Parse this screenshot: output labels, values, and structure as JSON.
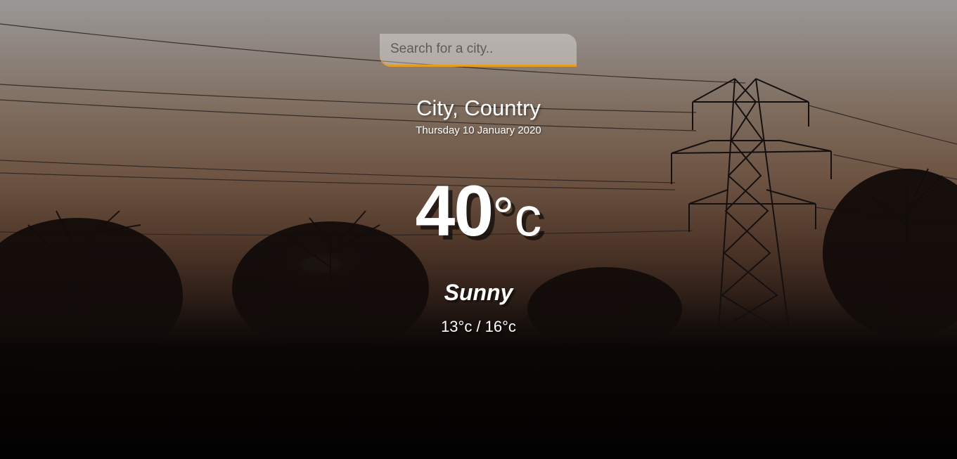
{
  "search": {
    "placeholder": "Search for a city.."
  },
  "location": {
    "name": "City, Country",
    "date": "Thursday 10 January 2020"
  },
  "current": {
    "temperature": "40",
    "unit": "°c",
    "condition": "Sunny",
    "hi_low": "13°c / 16°c"
  },
  "colors": {
    "accent": "#e89c1f",
    "text": "#ffffff"
  }
}
